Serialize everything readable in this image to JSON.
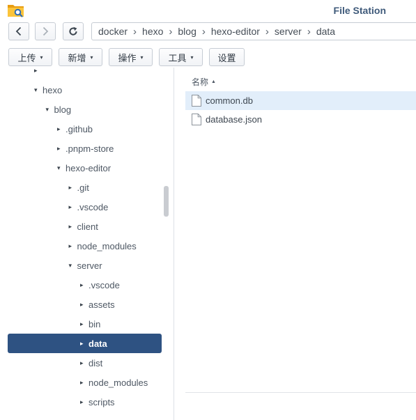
{
  "window": {
    "title": "File Station",
    "app_icon": "file-station-folder-icon"
  },
  "nav": {
    "back_icon": "chevron-left-icon",
    "forward_icon": "chevron-right-icon",
    "forward_enabled": false,
    "refresh_icon": "refresh-icon"
  },
  "path": {
    "separator_icon": "chevron-right-icon",
    "crumbs": [
      "docker",
      "hexo",
      "blog",
      "hexo-editor",
      "server",
      "data"
    ]
  },
  "toolbar": {
    "buttons": [
      {
        "label": "上传",
        "dropdown": true
      },
      {
        "label": "新增",
        "dropdown": true
      },
      {
        "label": "操作",
        "dropdown": true
      },
      {
        "label": "工具",
        "dropdown": true
      },
      {
        "label": "设置",
        "dropdown": false
      }
    ]
  },
  "tree": {
    "items": [
      {
        "label": "",
        "level": 1,
        "expanded": false,
        "selected": false
      },
      {
        "label": "hexo",
        "level": 1,
        "expanded": true,
        "selected": false
      },
      {
        "label": "blog",
        "level": 2,
        "expanded": true,
        "selected": false
      },
      {
        "label": ".github",
        "level": 3,
        "expanded": false,
        "selected": false
      },
      {
        "label": ".pnpm-store",
        "level": 3,
        "expanded": false,
        "selected": false
      },
      {
        "label": "hexo-editor",
        "level": 3,
        "expanded": true,
        "selected": false
      },
      {
        "label": ".git",
        "level": 4,
        "expanded": false,
        "selected": false
      },
      {
        "label": ".vscode",
        "level": 4,
        "expanded": false,
        "selected": false
      },
      {
        "label": "client",
        "level": 4,
        "expanded": false,
        "selected": false
      },
      {
        "label": "node_modules",
        "level": 4,
        "expanded": false,
        "selected": false
      },
      {
        "label": "server",
        "level": 4,
        "expanded": true,
        "selected": false
      },
      {
        "label": ".vscode",
        "level": 5,
        "expanded": false,
        "selected": false
      },
      {
        "label": "assets",
        "level": 5,
        "expanded": false,
        "selected": false
      },
      {
        "label": "bin",
        "level": 5,
        "expanded": false,
        "selected": false
      },
      {
        "label": "data",
        "level": 5,
        "expanded": false,
        "selected": true
      },
      {
        "label": "dist",
        "level": 5,
        "expanded": false,
        "selected": false
      },
      {
        "label": "node_modules",
        "level": 5,
        "expanded": false,
        "selected": false
      },
      {
        "label": "scripts",
        "level": 5,
        "expanded": false,
        "selected": false
      }
    ]
  },
  "file_list": {
    "columns": [
      {
        "label": "名称",
        "sort": "ascending",
        "sort_icon": "sort-ascending-icon"
      }
    ],
    "rows": [
      {
        "name": "common.db",
        "icon": "file-icon",
        "selected": true
      },
      {
        "name": "database.json",
        "icon": "file-icon",
        "selected": false
      }
    ]
  },
  "colors": {
    "accent": "#2e5282",
    "row_highlight": "#e2eefa",
    "title": "#3f5a7a",
    "text": "#4d5763"
  }
}
